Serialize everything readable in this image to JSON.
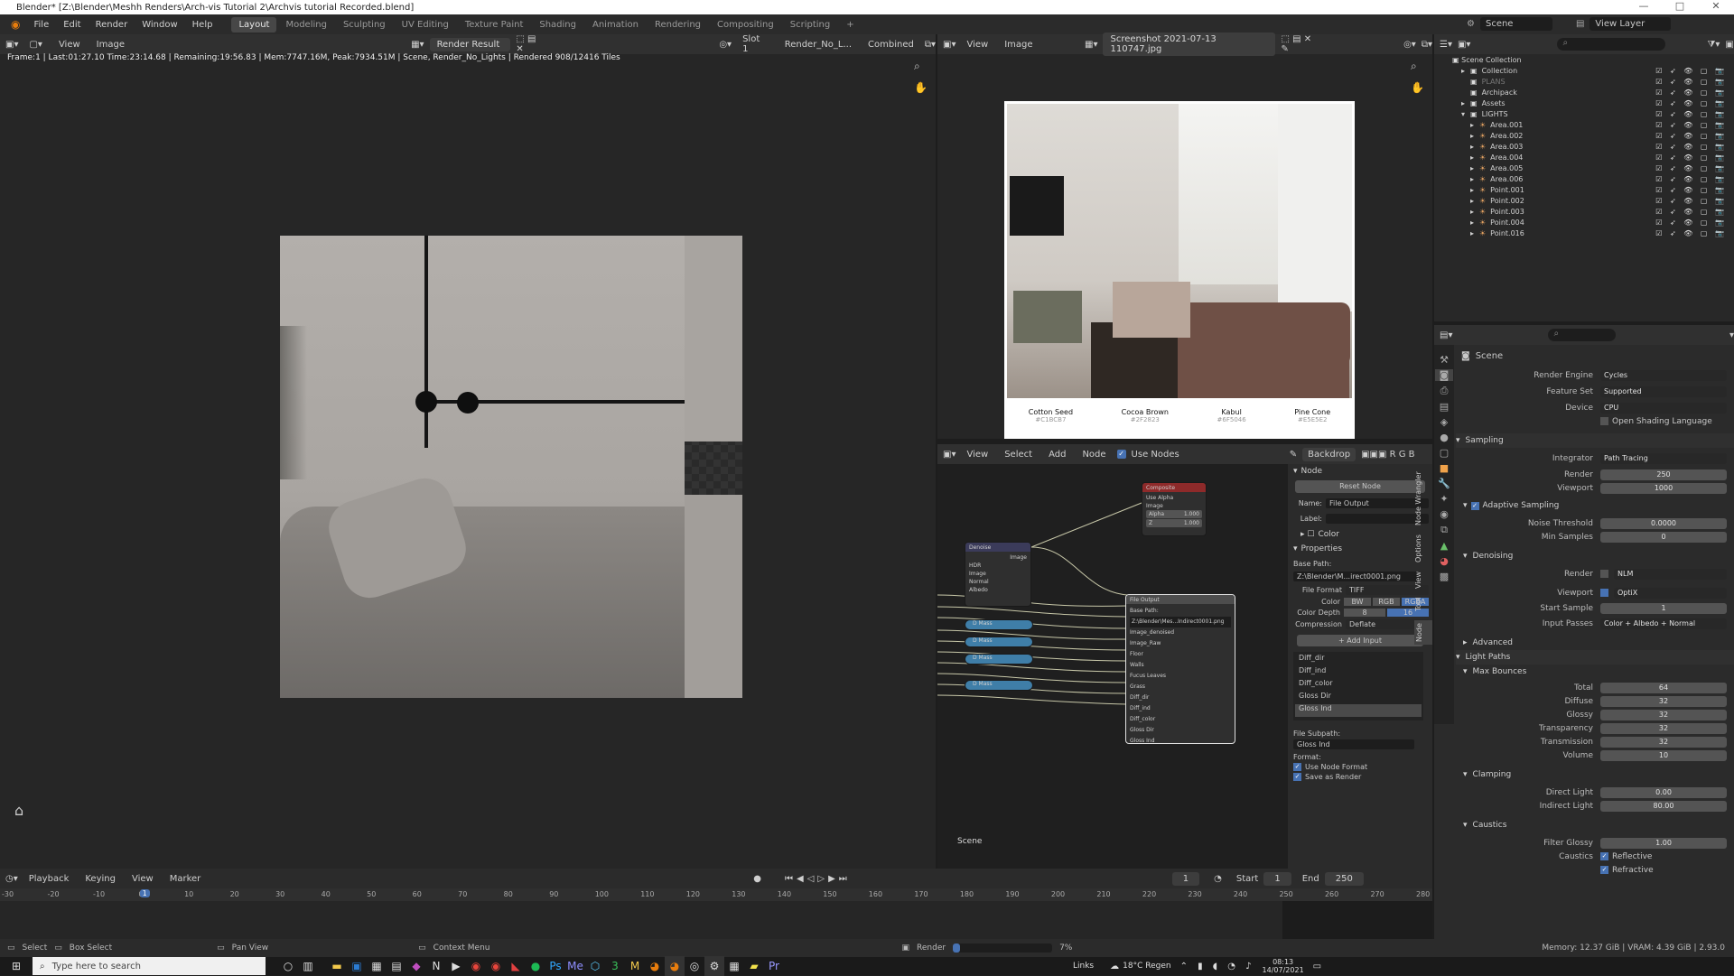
{
  "window": {
    "title": "Blender* [Z:\\Blender\\Meshh Renders\\Arch-vis Tutorial 2\\Archvis tutorial Recorded.blend]",
    "controls": [
      "—",
      "□",
      "✕"
    ]
  },
  "menu": {
    "items": [
      "File",
      "Edit",
      "Render",
      "Window",
      "Help"
    ],
    "workspaces": [
      "Layout",
      "Modeling",
      "Sculpting",
      "UV Editing",
      "Texture Paint",
      "Shading",
      "Animation",
      "Rendering",
      "Compositing",
      "Scripting"
    ],
    "active_workspace": "Layout",
    "add_tab": "+",
    "scene": "Scene",
    "view_layer": "View Layer"
  },
  "render_view": {
    "header": {
      "view": "View",
      "image": "Image",
      "image_name": "Render Result",
      "slot": "Slot 1",
      "layer": "Render_No_L...",
      "pass": "Combined"
    },
    "stats": "Frame:1 | Last:01:27.10 Time:23:14.68 | Remaining:19:56.83 | Mem:7747.16M, Peak:7934.51M | Scene, Render_No_Lights | Rendered 908/12416 Tiles"
  },
  "image_view": {
    "header": {
      "view": "View",
      "image": "Image",
      "image_name": "Screenshot 2021-07-13 110747.jpg"
    },
    "swatches": [
      {
        "name": "Cotton Seed",
        "hex": "#C1BCB7",
        "color": "#c1bcb7"
      },
      {
        "name": "Cocoa Brown",
        "hex": "#2F2823",
        "color": "#2f2823"
      },
      {
        "name": "Kabul",
        "hex": "#6F5046",
        "color": "#6f5046"
      },
      {
        "name": "Pine Cone",
        "hex": "#E5E5E2",
        "color": "#e5e5e2"
      }
    ]
  },
  "node_editor": {
    "header": {
      "view": "View",
      "select": "Select",
      "add": "Add",
      "node": "Node",
      "use_nodes": "Use Nodes",
      "backdrop": "Backdrop"
    },
    "scene_label": "Scene",
    "nodes": {
      "composite": {
        "title": "Composite",
        "use_alpha": "Use Alpha",
        "image": "Image",
        "alpha": "Alpha",
        "alpha_val": "1.000",
        "z": "Z",
        "z_val": "1.000"
      },
      "denoise": {
        "title": "Denoise",
        "image": "Image",
        "hdr": "HDR",
        "in_image": "Image",
        "normal": "Normal",
        "albedo": "Albedo"
      },
      "file_output": {
        "title": "File Output",
        "base_path": "Base Path:",
        "path": "Z:\\Blender\\Mes...Indirect0001.png",
        "inputs": [
          "Image_denoised",
          "Image_Raw",
          "Floor",
          "Walls",
          "Fucus Leaves",
          "Grass",
          "Diff_dir",
          "Diff_ind",
          "Diff_color",
          "Gloss Dir",
          "Gloss Ind"
        ],
        "fmt": "TIFF"
      },
      "reroutes": [
        "D Mass",
        "D Mass",
        "D Mass",
        "D Mass"
      ]
    },
    "sidebar": {
      "tabs": [
        "Node",
        "Tool",
        "View",
        "Options",
        "Node Wrangler"
      ],
      "node_section": "Node",
      "reset_node": "Reset Node",
      "name_label": "Name:",
      "name_value": "File Output",
      "label_label": "Label:",
      "label_value": "",
      "color_label": "Color",
      "properties_section": "Properties",
      "base_path_label": "Base Path:",
      "base_path_value": "Z:\\Blender\\M...irect0001.png",
      "file_format_label": "File Format",
      "file_format_value": "TIFF",
      "color_mode_label": "Color",
      "color_modes": [
        "BW",
        "RGB",
        "RGBA"
      ],
      "active_color_mode": "RGBA",
      "color_depth_label": "Color Depth",
      "color_depths": [
        "8",
        "16"
      ],
      "active_depth": "16",
      "compression_label": "Compression",
      "compression_value": "Deflate",
      "add_input": "Add Input",
      "inputs_list": [
        "Diff_dir",
        "Diff_ind",
        "Diff_color",
        "Gloss Dir",
        "Gloss Ind"
      ],
      "selected_input": "Gloss Ind",
      "file_subpath_label": "File Subpath:",
      "file_subpath_value": "Gloss Ind",
      "format_label": "Format:",
      "use_node_format": "Use Node Format",
      "save_as_render": "Save as Render"
    }
  },
  "outliner": {
    "root": "Scene Collection",
    "items": [
      {
        "name": "Collection",
        "level": 1,
        "expand": "▸",
        "dim": false
      },
      {
        "name": "PLANS",
        "level": 1,
        "expand": "",
        "dim": true
      },
      {
        "name": "Archipack",
        "level": 1,
        "expand": "",
        "dim": false
      },
      {
        "name": "Assets",
        "level": 1,
        "expand": "▸",
        "dim": false
      },
      {
        "name": "LIGHTS",
        "level": 1,
        "expand": "▾",
        "dim": false
      },
      {
        "name": "Area.001",
        "level": 2,
        "expand": "▸",
        "dim": false
      },
      {
        "name": "Area.002",
        "level": 2,
        "expand": "▸",
        "dim": false
      },
      {
        "name": "Area.003",
        "level": 2,
        "expand": "▸",
        "dim": false
      },
      {
        "name": "Area.004",
        "level": 2,
        "expand": "▸",
        "dim": false
      },
      {
        "name": "Area.005",
        "level": 2,
        "expand": "▸",
        "dim": false
      },
      {
        "name": "Area.006",
        "level": 2,
        "expand": "▸",
        "dim": false
      },
      {
        "name": "Point.001",
        "level": 2,
        "expand": "▸",
        "dim": false
      },
      {
        "name": "Point.002",
        "level": 2,
        "expand": "▸",
        "dim": false
      },
      {
        "name": "Point.003",
        "level": 2,
        "expand": "▸",
        "dim": false
      },
      {
        "name": "Point.004",
        "level": 2,
        "expand": "▸",
        "dim": false
      },
      {
        "name": "Point.016",
        "level": 2,
        "expand": "▸",
        "dim": false
      }
    ]
  },
  "properties": {
    "scene": "Scene",
    "render_engine_label": "Render Engine",
    "render_engine": "Cycles",
    "feature_set_label": "Feature Set",
    "feature_set": "Supported",
    "device_label": "Device",
    "device": "CPU",
    "osl": "Open Shading Language",
    "sampling": "Sampling",
    "integrator_label": "Integrator",
    "integrator": "Path Tracing",
    "render_label": "Render",
    "render_samples": "250",
    "viewport_label": "Viewport",
    "viewport_samples": "1000",
    "adaptive": "Adaptive Sampling",
    "noise_label": "Noise Threshold",
    "noise": "0.0000",
    "min_label": "Min Samples",
    "min": "0",
    "denoising": "Denoising",
    "dn_render_label": "Render",
    "dn_render": "NLM",
    "dn_viewport_label": "Viewport",
    "dn_viewport": "OptiX",
    "start_sample_label": "Start Sample",
    "start_sample": "1",
    "input_passes_label": "Input Passes",
    "input_passes": "Color + Albedo + Normal",
    "advanced": "Advanced",
    "light_paths": "Light Paths",
    "max_bounces": "Max Bounces",
    "bounces": [
      {
        "label": "Total",
        "value": "64"
      },
      {
        "label": "Diffuse",
        "value": "32"
      },
      {
        "label": "Glossy",
        "value": "32"
      },
      {
        "label": "Transparency",
        "value": "32"
      },
      {
        "label": "Transmission",
        "value": "32"
      },
      {
        "label": "Volume",
        "value": "10"
      }
    ],
    "clamping": "Clamping",
    "direct_label": "Direct Light",
    "direct": "0.00",
    "indirect_label": "Indirect Light",
    "indirect": "80.00",
    "caustics": "Caustics",
    "filter_glossy_label": "Filter Glossy",
    "filter_glossy": "1.00",
    "caustics_label": "Caustics",
    "reflective": "Reflective",
    "refractive": "Refractive"
  },
  "timeline": {
    "playback": "Playback",
    "keying": "Keying",
    "view": "View",
    "marker": "Marker",
    "current": "1",
    "start_label": "Start",
    "start": "1",
    "end_label": "End",
    "end": "250",
    "ticks": [
      "-30",
      "-20",
      "-10",
      "0",
      "10",
      "20",
      "30",
      "40",
      "50",
      "60",
      "70",
      "80",
      "90",
      "100",
      "110",
      "120",
      "130",
      "140",
      "150",
      "160",
      "170",
      "180",
      "190",
      "200",
      "210",
      "220",
      "230",
      "240",
      "250",
      "260",
      "270",
      "280"
    ],
    "cursor_label": "1"
  },
  "statusbar": {
    "select": "Select",
    "box_select": "Box Select",
    "pan_view": "Pan View",
    "context_menu": "Context Menu",
    "render": "Render",
    "progress": "7%",
    "progress_fraction": 0.07,
    "memory": "Memory: 12.37 GiB | VRAM: 4.39 GiB | 2.93.0"
  },
  "taskbar": {
    "search_placeholder": "Type here to search",
    "links": "Links",
    "weather": "18°C Regen",
    "time": "08:13",
    "date": "14/07/2021"
  }
}
